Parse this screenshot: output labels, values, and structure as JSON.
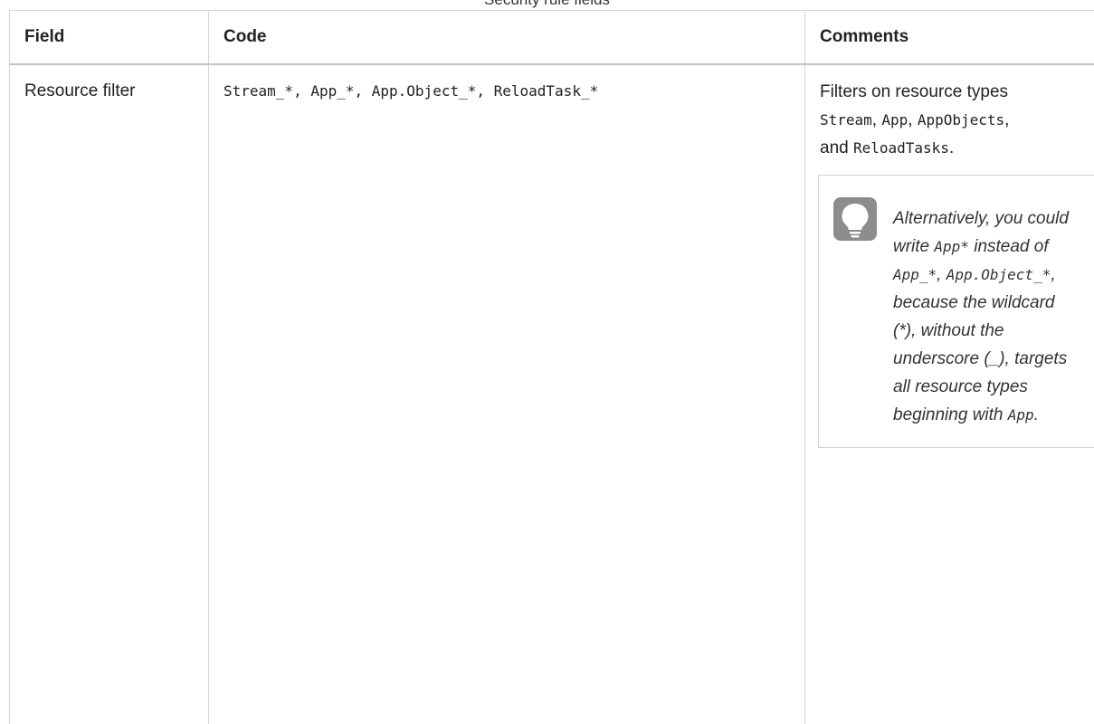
{
  "caption": "Security rule fields",
  "table": {
    "headers": {
      "field": "Field",
      "code": "Code",
      "comments": "Comments"
    },
    "row": {
      "field": "Resource filter",
      "code": "Stream_*, App_*, App.Object_*, ReloadTask_*",
      "comments": {
        "intro": "Filters on resource types",
        "type_stream": "Stream",
        "sep1": ", ",
        "type_app": "App",
        "sep2": ", ",
        "type_appobjects": "AppObjects",
        "sep3": ",",
        "and_word": "and ",
        "type_reloadtasks": "ReloadTasks",
        "period": "."
      },
      "tip": {
        "icon": "lightbulb-icon",
        "t1": "Alternatively, you could write ",
        "c1": "App*",
        "t2": " instead of ",
        "c2": "App_*",
        "t3": ", ",
        "c3": "App.Object_*",
        "t4": ", because the wildcard (*), without the underscore (_), targets all resource types beginning with ",
        "c4": "App",
        "t5": "."
      }
    }
  },
  "colors": {
    "border": "#d6d6d6",
    "tip_icon_bg": "#8c8c8c"
  }
}
